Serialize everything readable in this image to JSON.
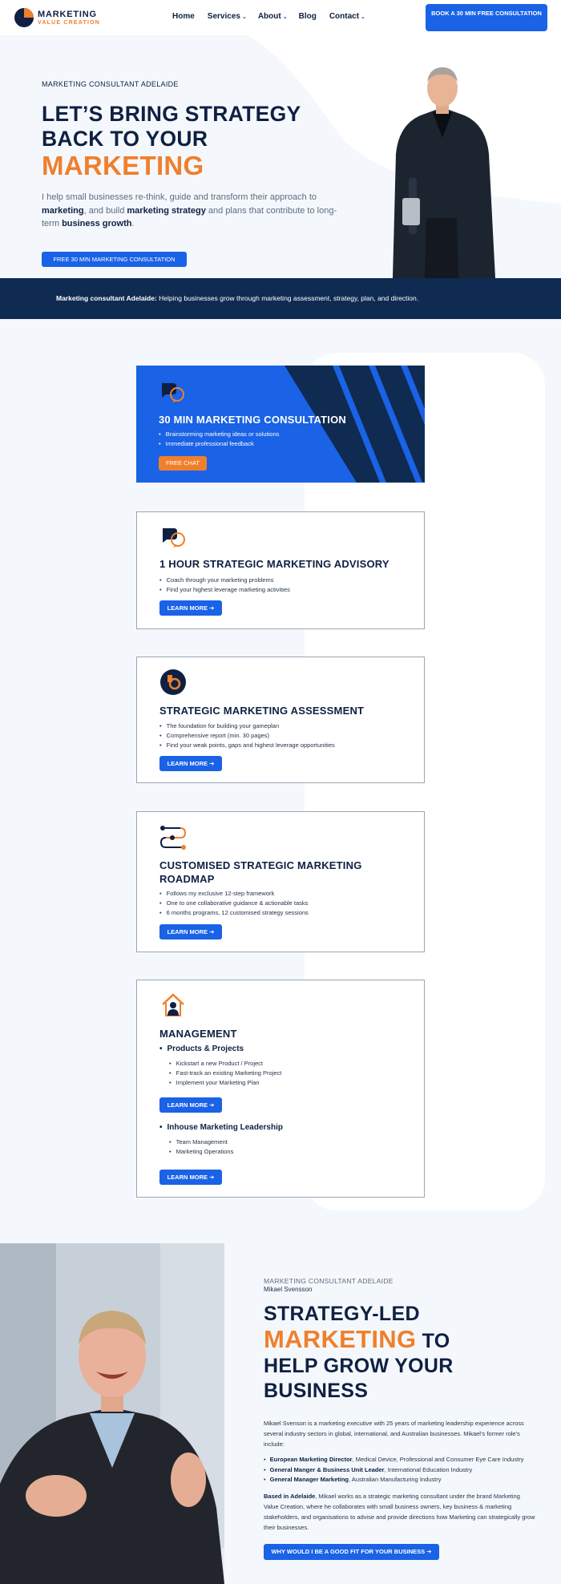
{
  "header": {
    "logo_top": "MARKETING",
    "logo_bottom": "VALUE CREATION",
    "nav": [
      {
        "label": "Home",
        "caret": ""
      },
      {
        "label": "Services",
        "caret": "⌄"
      },
      {
        "label": "About",
        "caret": "⌄"
      },
      {
        "label": "Blog",
        "caret": ""
      },
      {
        "label": "Contact",
        "caret": "⌄"
      }
    ],
    "cta": "BOOK A 30 MIN FREE CONSULTATION"
  },
  "hero": {
    "eyebrow": "MARKETING CONSULTANT ADELAIDE",
    "h1_line1": "LET’S BRING STRATEGY",
    "h1_line2": "BACK TO YOUR",
    "h1_orange": "MARKETING",
    "p_1": "I help small businesses re-think, guide and transform their approach to",
    "p_b1": "marketing",
    "p_2": ", and build",
    "p_b2": "marketing strategy",
    "p_3": "and plans that contribute to long-term",
    "p_b3": "business growth",
    "p_4": ".",
    "button": "FREE 30 MIN MARKETING CONSULTATION"
  },
  "band": {
    "bold": "Marketing consultant Adelaide:",
    "text": " Helping businesses grow through marketing assessment, strategy, plan, and direction."
  },
  "services": {
    "consult": {
      "title": "30 MIN MARKETING CONSULTATION",
      "bullets": [
        "Brainstorming marketing ideas or solutions",
        "Immediate professional feedback"
      ],
      "button": "FREE CHAT",
      "icon": "chat-bubbles-icon"
    },
    "advisory": {
      "title": "1 HOUR STRATEGIC MARKETING ADVISORY",
      "bullets": [
        "Coach through your marketing problems",
        "Find your highest leverage marketing activities"
      ],
      "button": "LEARN MORE ➔",
      "icon": "chat-bubbles-icon"
    },
    "assessment": {
      "title": "STRATEGIC MARKETING ASSESSMENT",
      "bullets": [
        "The foundation for building your gameplan",
        "Comprehensive report (min. 30 pages)",
        "Find your weak points, gaps and highest leverage opportunities"
      ],
      "button": "LEARN MORE ➔",
      "icon": "magnifier-icon"
    },
    "roadmap": {
      "title_l1": "CUSTOMISED STRATEGIC MARKETING",
      "title_l2": "ROADMAP",
      "bullets": [
        "Follows my exclusive 12-step framework",
        "One to one collaborative guidance & actionable tasks",
        "6 months programs, 12 customised strategy sessions"
      ],
      "button": "LEARN MORE ➔",
      "icon": "roadmap-icon"
    },
    "management": {
      "title": "MANAGEMENT",
      "sub1": "Products & Projects",
      "sub1_bullets": [
        "Kickstart a new Product / Project",
        "Fast-track an existing Marketing Project",
        "Implement your Marketing Plan"
      ],
      "button1": "LEARN MORE ➔",
      "sub2": "Inhouse Marketing Leadership",
      "sub2_bullets": [
        "Team Management",
        "Marketing Operations"
      ],
      "button2": "LEARN MORE ➔",
      "icon": "house-person-icon"
    }
  },
  "about": {
    "eyebrow": "MARKETING CONSULTANT ADELAIDE",
    "name": "Mikael Svensson",
    "h2_l1": "STRATEGY-LED",
    "h2_orange": "MARKETING",
    "h2_to": " TO",
    "h2_l3": "HELP GROW YOUR",
    "h2_l4": "BUSINESS",
    "p1": "Mikael Svenson is a marketing executive with 25 years of marketing leadership experience across several industry sectors in global, international, and Australian businesses.  Mikael’s former role’s include:",
    "roles": [
      {
        "bold": "European Marketing Director",
        "text": ", Medical Device, Professional and Consumer Eye Care Industry"
      },
      {
        "bold": "General Manger & Business Unit Leader",
        "text": ", International Education Industry"
      },
      {
        "bold": "General Manager Marketing",
        "text": ", Australian Manufacturing Industry"
      }
    ],
    "p2_bold": "Based in Adelaide",
    "p2": ", Mikael works as a strategic marketing consultant under the brand Marketing Value Creation, where he collaborates with small business owners, key business & marketing stakeholders, and organisations to advise and provide directions how Marketing can strategically grow their businesses.",
    "button": "WHY WOULD I BE A GOOD FIT FOR YOUR BUSINESS ➔"
  }
}
